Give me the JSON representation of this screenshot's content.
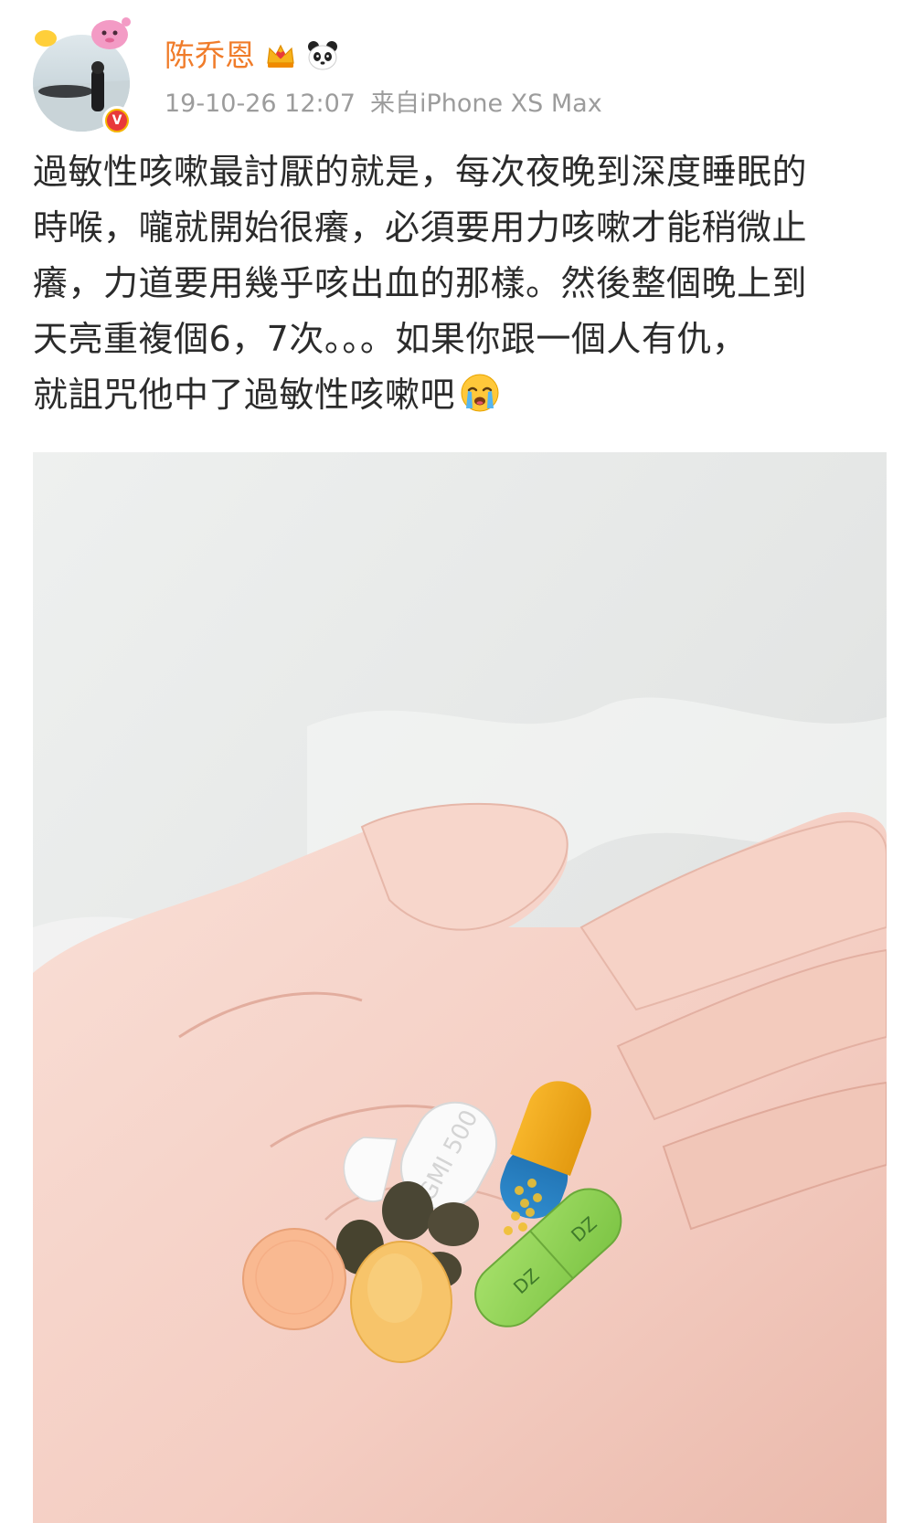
{
  "post": {
    "author": {
      "name": "陈乔恩",
      "verified_badge": "V",
      "badges": [
        "vip-crown-icon",
        "panda-icon"
      ]
    },
    "meta": {
      "time": "19-10-26 12:07",
      "source": "来自iPhone XS Max"
    },
    "text_lines": [
      "過敏性咳嗽最討厭的就是，每次夜晚到深度睡眠的",
      "時喉，嚨就開始很癢，必須要用力咳嗽才能稍微止",
      "癢，力道要用幾乎咳出血的那樣。然後整個晚上到",
      "天亮重複個6，7次。。。如果你跟一個人有仇，",
      "就詛咒他中了過敏性咳嗽吧"
    ],
    "text_emoji": "crying-face-icon",
    "image": {
      "subject": "hand-holding-pills-photo",
      "capsule_print": "DZ"
    }
  },
  "colors": {
    "username": "#f07c2a",
    "meta": "#9c9c9c",
    "body_text": "#2b2b2b",
    "verified_outer": "#f5b400",
    "verified_inner": "#e8393a"
  }
}
